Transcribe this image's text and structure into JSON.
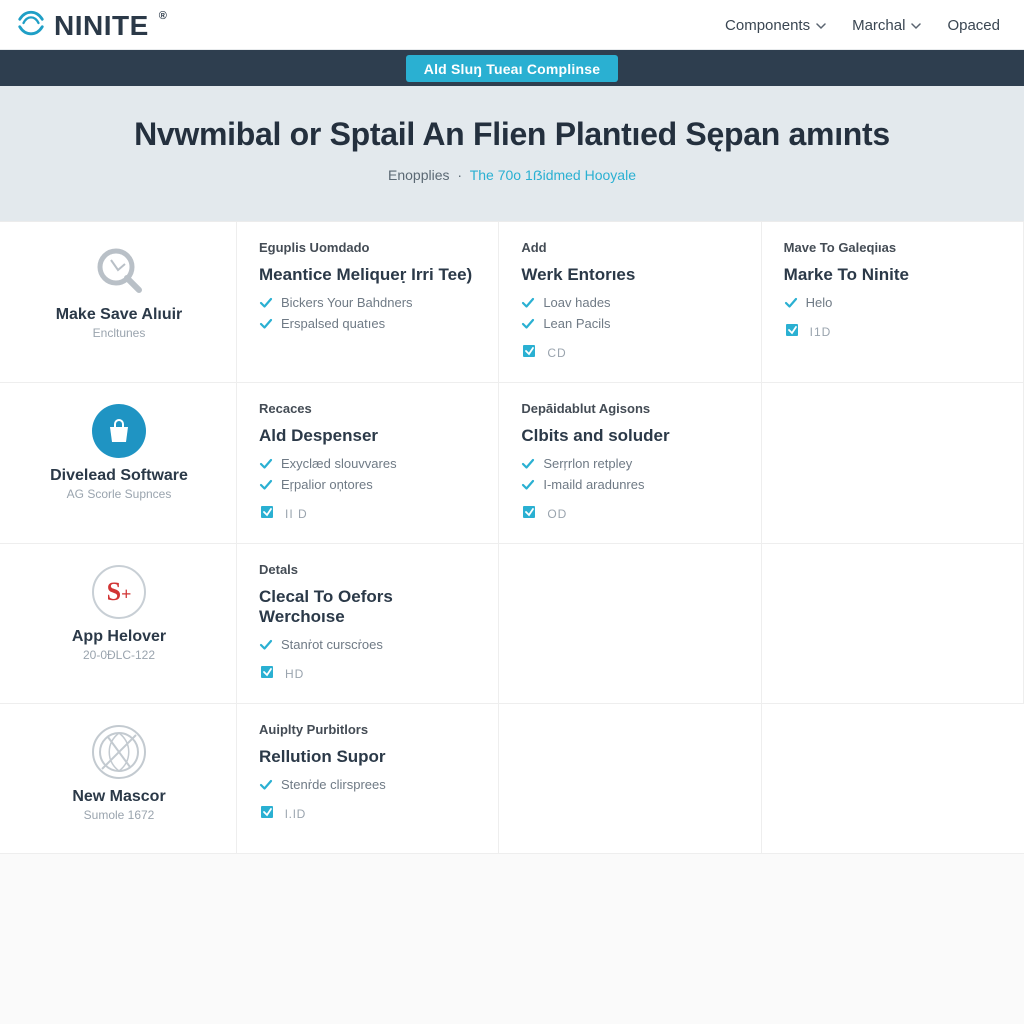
{
  "brand": "NINITE",
  "nav": {
    "components": "Components",
    "marchal": "Marchal",
    "opaced": "Opaced"
  },
  "pill": "Ald Sluŋ Tueaı Complinse",
  "hero": {
    "title": "Nvwmibal or Sptail An Flien Plantıed Sępan amınts",
    "sub_prefix": "Enopplies",
    "sub_link": "The 70o 1ẞidmed Hooyale"
  },
  "rows": [
    {
      "side": {
        "icon": "magnify",
        "title": "Make Save Alıuir",
        "sub": "Encltunes"
      },
      "cards": [
        {
          "eyebrow": "Eguplis Uomdado",
          "title": "Meantice Meliqueṛ Irri Tee)",
          "items": [
            "Bickers Your Bahdners",
            "Erspalsed quatıes"
          ],
          "badge": ""
        },
        {
          "eyebrow": "Add",
          "title": "Werk Entorıes",
          "items": [
            "Loav hades",
            "Lean Pacils"
          ],
          "badge": "CD"
        },
        {
          "eyebrow": "Mave To Galeqiıas",
          "title": "Marke To Ninite",
          "items": [
            "Helo"
          ],
          "badge": "I1D"
        }
      ]
    },
    {
      "side": {
        "icon": "bag",
        "title": "Divelead Software",
        "sub": "AG Scorle Supnces"
      },
      "cards": [
        {
          "eyebrow": "Recaces",
          "title": "Ald Despenser",
          "items": [
            "Exyclæd slouvvares",
            "Eŗpalior oņtores"
          ],
          "badge": "II D"
        },
        {
          "eyebrow": "Depāidablut Agisons",
          "title": "Clbits and soluder",
          "items": [
            "Serŗrlon retpley",
            "I-maild aradunres"
          ],
          "badge": "OD"
        },
        {
          "empty": true
        }
      ]
    },
    {
      "side": {
        "icon": "splus",
        "title": "App Helover",
        "sub": "20-0ÐLC-122"
      },
      "cards": [
        {
          "eyebrow": "Detals",
          "title": "Clecal To Oefors Werchoıse",
          "items": [
            "Stanṙot cursсṙoes"
          ],
          "badge": "HD"
        },
        {
          "empty": true
        },
        {
          "empty": true
        }
      ]
    },
    {
      "side": {
        "icon": "globe",
        "title": "New Mascor",
        "sub": "Sumole 1672"
      },
      "cards": [
        {
          "eyebrow": "Auiplty Purbitlors",
          "title": "Rellution Supor",
          "items": [
            "Stenṙde clirsprees"
          ],
          "badge": "l.lD"
        },
        {
          "empty": true
        },
        {
          "empty": true
        }
      ]
    }
  ]
}
